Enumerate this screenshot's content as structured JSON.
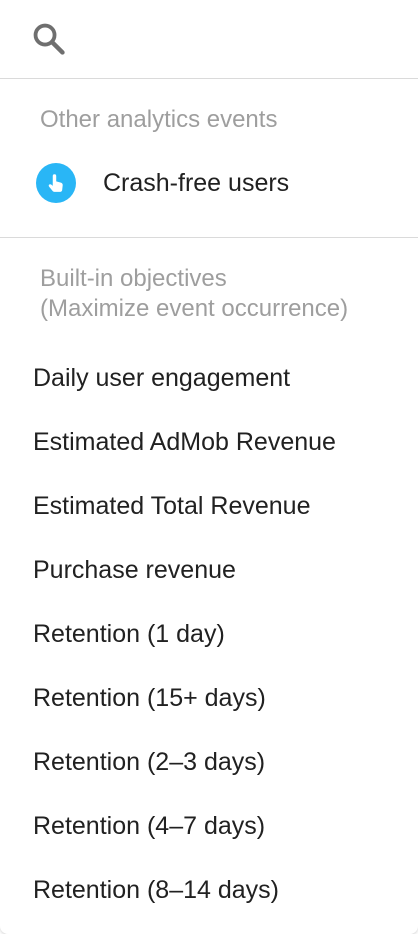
{
  "search": {
    "placeholder": "",
    "value": ""
  },
  "analytics_section": {
    "label": "Other analytics events",
    "items": [
      {
        "label": "Crash-free users",
        "icon": "touch-icon",
        "icon_color": "#29b6f6"
      }
    ]
  },
  "objectives_section": {
    "label_line1": "Built-in objectives",
    "label_line2": "(Maximize event occurrence)",
    "items": [
      {
        "label": "Daily user engagement"
      },
      {
        "label": "Estimated AdMob Revenue"
      },
      {
        "label": "Estimated Total Revenue"
      },
      {
        "label": "Purchase revenue"
      },
      {
        "label": "Retention (1 day)"
      },
      {
        "label": "Retention (15+ days)"
      },
      {
        "label": "Retention (2–3 days)"
      },
      {
        "label": "Retention (4–7 days)"
      },
      {
        "label": "Retention (8–14 days)"
      }
    ]
  },
  "colors": {
    "accent": "#29b6f6",
    "muted_text": "#9e9e9e",
    "text": "#212121",
    "divider": "#dadada"
  }
}
